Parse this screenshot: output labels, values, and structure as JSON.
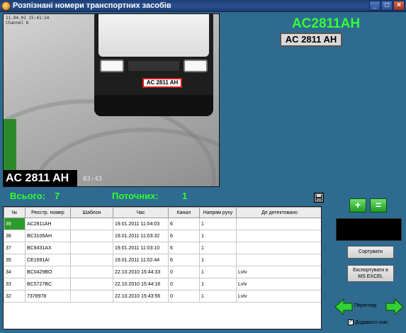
{
  "window": {
    "title": "Розпізнані номери транспортних засобів",
    "buttons": [
      "_",
      "□",
      "×"
    ]
  },
  "video": {
    "osd_lines": [
      "11.04.01 15:41:14",
      "Channel 6"
    ],
    "osd_time": "03:43",
    "plate_text_in_frame": "AC 2811 AH",
    "recognized_overlay": "AC 2811 AH"
  },
  "recognition": {
    "plate_text": "AC2811AH",
    "plate_image_text": "AC 2811 AH"
  },
  "stats": {
    "total_label": "Всього:",
    "total_value": "7",
    "current_label": "Поточних:",
    "current_value": "1"
  },
  "toolbar": {
    "save_icon": "floppy-disk-icon"
  },
  "table": {
    "headers": [
      "№",
      "Реєстр. номер",
      "Шаблон",
      "Час",
      "Канал",
      "Напрям руху",
      "Де детектовано"
    ],
    "rows": [
      {
        "num": "39",
        "plate": "AC2811AH",
        "template": "",
        "time": "19.01.2011 11:04:03",
        "channel": "6",
        "direction": "1",
        "location": ""
      },
      {
        "num": "38",
        "plate": "BC3106AH",
        "template": "",
        "time": "19.01.2011 11:03:32",
        "channel": "6",
        "direction": "1",
        "location": ""
      },
      {
        "num": "37",
        "plate": "BC8431AX",
        "template": "",
        "time": "19.01.2011 11:03:10",
        "channel": "6",
        "direction": "1",
        "location": ""
      },
      {
        "num": "35",
        "plate": "CE1691AI",
        "template": "",
        "time": "19.01.2011 11:02:44",
        "channel": "6",
        "direction": "1",
        "location": ""
      },
      {
        "num": "34",
        "plate": "BC0429BO",
        "template": "",
        "time": "22.10.2010 15:44:33",
        "channel": "0",
        "direction": "1",
        "location": "Lviv"
      },
      {
        "num": "33",
        "plate": "BC5727BC",
        "template": "",
        "time": "22.10.2010 15:44:16",
        "channel": "0",
        "direction": "1",
        "location": "Lviv"
      },
      {
        "num": "32",
        "plate": "7378978",
        "template": "",
        "time": "22.10.2010 15:43:56",
        "channel": "0",
        "direction": "1",
        "location": "Lviv"
      }
    ]
  },
  "side": {
    "plus_label": "+",
    "minus_label": "=",
    "display_text": "",
    "sort_label": "Сортувати",
    "export_label_1": "Експортувати в",
    "export_label_2": "MS EXCEL",
    "nav_label": "Перегляд",
    "add_new_label": "Додавати нові",
    "add_new_checked": "✓"
  },
  "colors": {
    "background": "#2f6b90",
    "accent_green": "#33ff33",
    "selected_row": "#2d9a2d"
  }
}
